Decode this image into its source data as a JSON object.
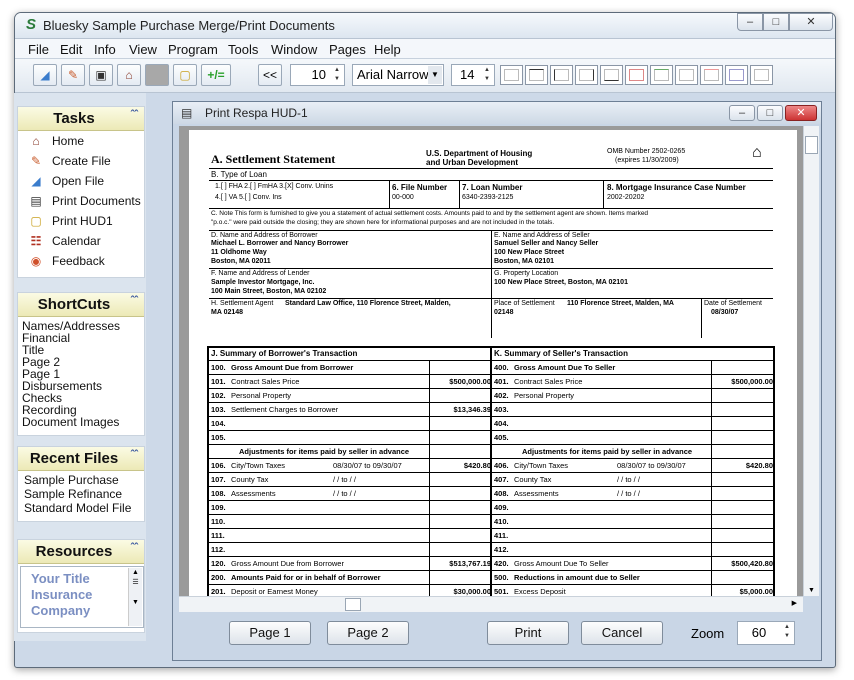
{
  "app": {
    "title": "Bluesky Sample Purchase Merge/Print Documents",
    "window_controls": [
      "–",
      "□",
      "✕"
    ]
  },
  "menu": [
    "File",
    "Edit",
    "Info",
    "View",
    "Program",
    "Tools",
    "Window",
    "Pages",
    "Help"
  ],
  "toolbar": {
    "prev_label": "<<",
    "page_size": "10",
    "font_name": "Arial Narrow",
    "font_size": "14",
    "add_label": "+/="
  },
  "sidebar": {
    "tasks": {
      "title": "Tasks",
      "items": [
        {
          "label": "Home",
          "icon": "home-icon"
        },
        {
          "label": "Create File",
          "icon": "create-file-icon"
        },
        {
          "label": "Open File",
          "icon": "open-file-icon"
        },
        {
          "label": "Print Documents",
          "icon": "print-documents-icon"
        },
        {
          "label": "Print HUD1",
          "icon": "print-hud1-icon"
        },
        {
          "label": "Calendar",
          "icon": "calendar-icon"
        },
        {
          "label": "Feedback",
          "icon": "feedback-icon"
        }
      ]
    },
    "shortcuts": {
      "title": "ShortCuts",
      "items": [
        "Names/Addresses",
        "Financial",
        "Title",
        "Page 2",
        "Page 1",
        "Disbursements",
        "Checks",
        "Recording",
        "Document Images"
      ]
    },
    "recent": {
      "title": "Recent Files",
      "items": [
        "Sample Purchase",
        "Sample Refinance",
        "Standard Model File"
      ]
    },
    "resources": {
      "title": "Resources",
      "text": "Your Title Insurance Company"
    }
  },
  "child": {
    "title": "Print Respa HUD-1"
  },
  "doc": {
    "heading": "A. Settlement Statement",
    "dept1": "U.S. Department of Housing",
    "dept2": "and Urban Development",
    "omb1": "OMB Number 2502-0265",
    "omb2": "(expires 11/30/2009)",
    "type_of_loan": "B. Type of Loan",
    "loan_opts1": "1.[ ] FHA  2.[ ] FmHA  3.[X] Conv. Unins",
    "loan_opts2": "4.[ ] VA   5.[ ] Conv. Ins",
    "file_no_label": "6. File Number",
    "file_no": "00-000",
    "loan_no_label": "7. Loan Number",
    "loan_no": "6340-2393-2125",
    "mic_label": "8. Mortgage Insurance Case Number",
    "mic": "2002-20202",
    "note1": "C. Note  This form is furnished to give you a statement of actual settlement costs. Amounts paid to and by the settlement agent are shown. Items marked",
    "note2": "\"p.o.c.\" were paid outside the closing; they are shown here for informational purposes and are not included in the totals.",
    "borrower_label": "D. Name and Address of Borrower",
    "borrower": [
      "Michael L. Borrower and Nancy Borrower",
      "11 Oldhome Way",
      "Boston, MA 02011"
    ],
    "seller_label": "E. Name and Address of Seller",
    "seller": [
      "Samuel Seller and Nancy Seller",
      "100 New Place Street",
      "Boston, MA 02101"
    ],
    "lender_label": "F. Name and Address of Lender",
    "lender": [
      "Sample Investor Mortgage, Inc.",
      "100 Main Street, Boston, MA 02102"
    ],
    "property_label": "G. Property Location",
    "property": "100 New Place Street, Boston, MA 02101",
    "agent_label": "H. Settlement Agent",
    "agent": "Standard Law Office, 110 Florence Street, Malden,",
    "agent2": "MA 02148",
    "place_label": "Place of Settlement",
    "place": "110 Florence Street, Malden, MA",
    "place2": "02148",
    "date_label": "Date of Settlement",
    "date": "08/30/07",
    "j_title": "J.     Summary of Borrower's Transaction",
    "k_title": "K.     Summary of Seller's Transaction",
    "rows_left": [
      {
        "n": "100.",
        "d": "Gross Amount Due from Borrower",
        "a": "",
        "bold": true
      },
      {
        "n": "101.",
        "d": "Contract Sales Price",
        "a": "$500,000.00"
      },
      {
        "n": "102.",
        "d": "Personal Property",
        "a": ""
      },
      {
        "n": "103.",
        "d": "Settlement Charges to Borrower",
        "a": "$13,346.39"
      },
      {
        "n": "104.",
        "d": "",
        "a": ""
      },
      {
        "n": "105.",
        "d": "",
        "a": ""
      }
    ],
    "rows_right": [
      {
        "n": "400.",
        "d": "Gross Amount Due To Seller",
        "a": "",
        "bold": true
      },
      {
        "n": "401.",
        "d": "Contract Sales Price",
        "a": "$500,000.00"
      },
      {
        "n": "402.",
        "d": "Personal Property",
        "a": ""
      },
      {
        "n": "403.",
        "d": "",
        "a": ""
      },
      {
        "n": "404.",
        "d": "",
        "a": ""
      },
      {
        "n": "405.",
        "d": "",
        "a": ""
      }
    ],
    "adj_title": "Adjustments for items paid by seller in advance",
    "adj_left": [
      {
        "n": "106.",
        "d": "City/Town Taxes",
        "p": "08/30/07 to 09/30/07",
        "a": "$420.80"
      },
      {
        "n": "107.",
        "d": "County Tax",
        "p": "/ /  to  / /",
        "a": ""
      },
      {
        "n": "108.",
        "d": "Assessments",
        "p": "/ /  to  / /",
        "a": ""
      },
      {
        "n": "109.",
        "d": "",
        "p": "",
        "a": ""
      },
      {
        "n": "110.",
        "d": "",
        "p": "",
        "a": ""
      },
      {
        "n": "111.",
        "d": "",
        "p": "",
        "a": ""
      },
      {
        "n": "112.",
        "d": "",
        "p": "",
        "a": ""
      }
    ],
    "adj_right": [
      {
        "n": "406.",
        "d": "City/Town Taxes",
        "p": "08/30/07 to 09/30/07",
        "a": "$420.80"
      },
      {
        "n": "407.",
        "d": "County Tax",
        "p": "/ /  to  / /",
        "a": ""
      },
      {
        "n": "408.",
        "d": "Assessments",
        "p": "/ /  to  / /",
        "a": ""
      },
      {
        "n": "409.",
        "d": "",
        "p": "",
        "a": ""
      },
      {
        "n": "410.",
        "d": "",
        "p": "",
        "a": ""
      },
      {
        "n": "411.",
        "d": "",
        "p": "",
        "a": ""
      },
      {
        "n": "412.",
        "d": "",
        "p": "",
        "a": ""
      }
    ],
    "tot_left": {
      "n": "120.",
      "d": "Gross Amount Due from Borrower",
      "a": "$513,767.19"
    },
    "tot_right": {
      "n": "420.",
      "d": "Gross Amount Due To Seller",
      "a": "$500,420.80"
    },
    "sec200": {
      "n": "200.",
      "d": "Amounts Paid for or in behalf of Borrower"
    },
    "sec500": {
      "n": "500.",
      "d": "Reductions in amount due to Seller"
    },
    "r201": {
      "n": "201.",
      "d": "Deposit or Earnest Money",
      "a": "$30,000.00"
    },
    "r501": {
      "n": "501.",
      "d": "Excess Deposit",
      "a": "$5,000.00"
    }
  },
  "buttons": {
    "page1": "Page 1",
    "page2": "Page 2",
    "print": "Print",
    "cancel": "Cancel",
    "zoom_label": "Zoom",
    "zoom_value": "60"
  }
}
